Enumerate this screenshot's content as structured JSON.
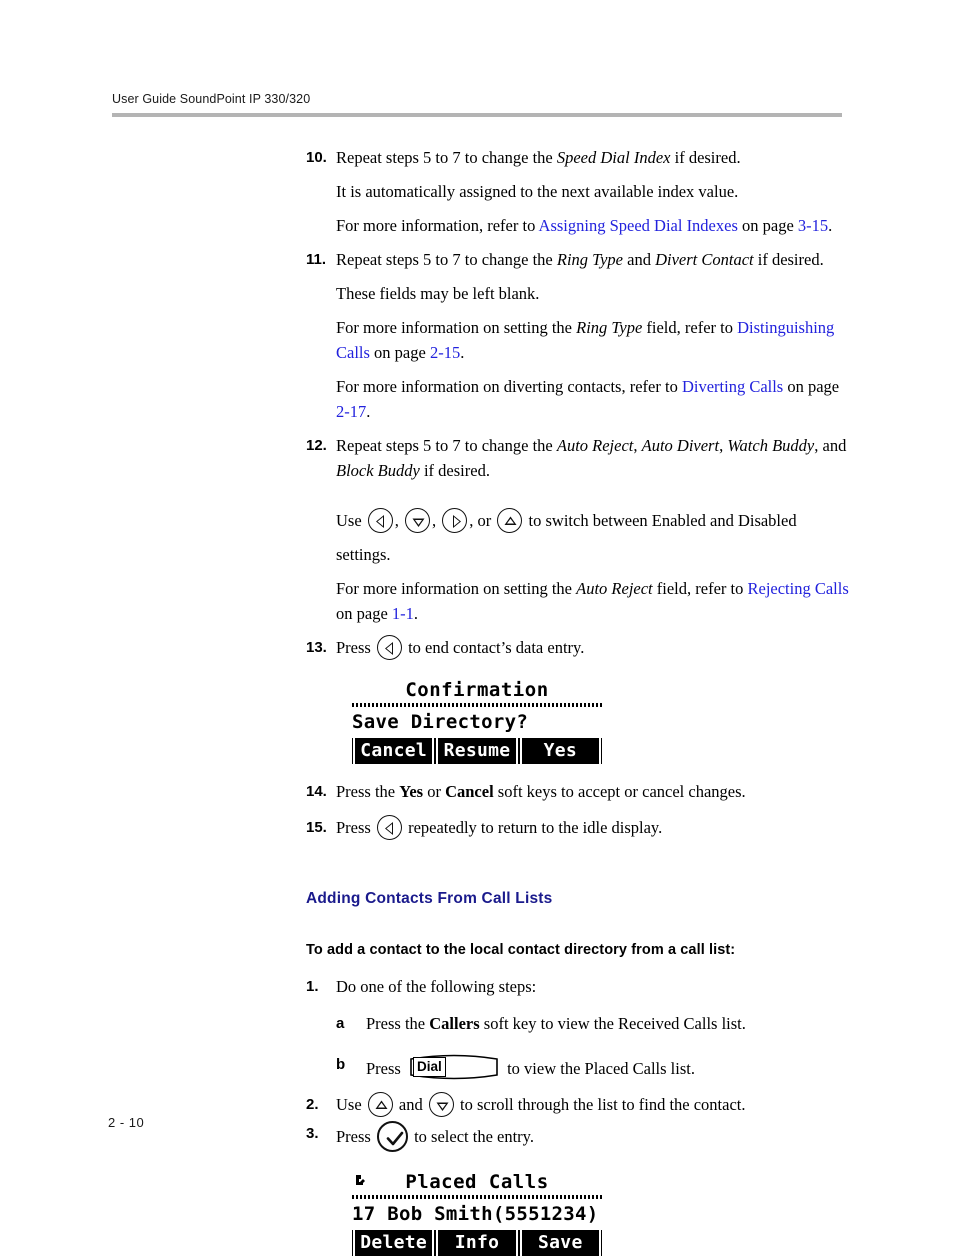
{
  "header": {
    "text": "User Guide SoundPoint IP 330/320"
  },
  "footer": {
    "page": "2 - 10"
  },
  "steps": {
    "s10": {
      "num": "10.",
      "line1_a": "Repeat steps 5 to 7 to change the ",
      "line1_term": "Speed Dial Index",
      "line1_b": " if desired.",
      "line2": "It is automatically assigned to the next available index value.",
      "line3_a": "For more information, refer to ",
      "line3_link": "Assigning Speed Dial Indexes",
      "line3_b": " on page ",
      "line3_page": "3-15",
      "line3_c": "."
    },
    "s11": {
      "num": "11.",
      "line1_a": "Repeat steps 5 to 7 to change the ",
      "line1_term1": "Ring Type",
      "line1_mid": " and ",
      "line1_term2": "Divert Contact",
      "line1_b": " if desired.",
      "line2": "These fields may be left blank.",
      "line3_a": "For more information on setting the ",
      "line3_term": "Ring Type",
      "line3_b": " field, refer to ",
      "line3_link": "Distinguishing Calls",
      "line3_c": " on page ",
      "line3_page": "2-15",
      "line3_d": ".",
      "line4_a": "For more information on diverting contacts, refer to ",
      "line4_link": "Diverting Calls",
      "line4_b": " on page ",
      "line4_page": "2-17",
      "line4_c": "."
    },
    "s12": {
      "num": "12.",
      "line1_a": "Repeat steps 5 to 7 to change the ",
      "line1_term1": "Auto Reject",
      "line1_c1": ", ",
      "line1_term2": "Auto Divert",
      "line1_c2": ", ",
      "line1_term3": "Watch Buddy",
      "line1_c3": ", and ",
      "line1_term4": "Block Buddy",
      "line1_b": " if desired.",
      "use_label": "Use ",
      "comma1": ", ",
      "comma2": ", ",
      "or_label": ", or ",
      "use_tail": " to switch between Enabled and Disabled",
      "settings": "settings.",
      "line3_a": "For more information on setting the ",
      "line3_term": "Auto Reject",
      "line3_b": " field, refer to ",
      "line3_link": "Rejecting Calls",
      "line3_c": " on page ",
      "line3_page": "1-1",
      "line3_d": "."
    },
    "s13": {
      "num": "13.",
      "press": "Press ",
      "tail": " to end contact’s data entry."
    },
    "s14": {
      "num": "14.",
      "a": "Press the ",
      "kw1": "Yes",
      "mid": " or ",
      "kw2": "Cancel",
      "b": " soft keys to accept or cancel changes."
    },
    "s15": {
      "num": "15.",
      "press": "Press ",
      "tail": " repeatedly to return to the idle display."
    }
  },
  "section": {
    "heading": "Adding Contacts From Call Lists",
    "subheading": "To add a contact to the local contact directory from a call list:"
  },
  "steps2": {
    "s1": {
      "num": "1.",
      "text": "Do one of the following steps:",
      "a": {
        "letter": "a",
        "pre": "Press the ",
        "kw": "Callers",
        "post": " soft key to view the Received Calls list."
      },
      "b": {
        "letter": "b",
        "pre": "Press ",
        "dial_label": "Dial",
        "post": " to view the Placed Calls list."
      }
    },
    "s2": {
      "num": "2.",
      "use": "Use ",
      "and": " and ",
      "tail": " to scroll through the list to find the contact."
    },
    "s3": {
      "num": "3.",
      "press": "Press ",
      "tail": " to select the entry."
    }
  },
  "lcd_confirmation": {
    "title": "Confirmation",
    "prompt": "Save Directory?",
    "softkeys": [
      "Cancel",
      "Resume",
      "Yes"
    ]
  },
  "lcd_placed_calls": {
    "title": "Placed Calls",
    "entry": "17 Bob Smith(5551234)",
    "softkeys": [
      "Delete",
      "Info",
      "Save"
    ]
  },
  "colors": {
    "link": "#2222dd",
    "heading": "#1a1a8c",
    "rule": "#b4b4b4"
  }
}
